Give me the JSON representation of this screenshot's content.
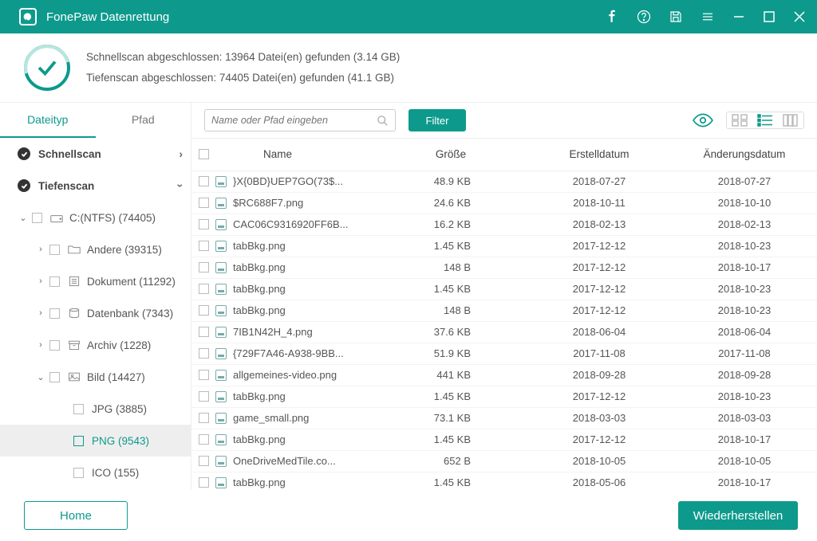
{
  "app": {
    "title": "FonePaw Datenrettung"
  },
  "status": {
    "line1": "Schnellscan abgeschlossen: 13964 Datei(en) gefunden (3.14 GB)",
    "line2": "Tiefenscan abgeschlossen: 74405 Datei(en) gefunden (41.1 GB)"
  },
  "tabs": {
    "filetype": "Dateityp",
    "path": "Pfad"
  },
  "tree": {
    "quickscan": "Schnellscan",
    "deepscan": "Tiefenscan",
    "drive": "C:(NTFS) (74405)",
    "cats": {
      "andere": "Andere (39315)",
      "dokument": "Dokument (11292)",
      "datenbank": "Datenbank (7343)",
      "archiv": "Archiv (1228)",
      "bild": "Bild (14427)"
    },
    "subs": {
      "jpg": "JPG (3885)",
      "png": "PNG (9543)",
      "ico": "ICO (155)"
    }
  },
  "toolbar": {
    "search_placeholder": "Name oder Pfad eingeben",
    "filter": "Filter"
  },
  "columns": {
    "name": "Name",
    "size": "Größe",
    "created": "Erstelldatum",
    "modified": "Änderungsdatum"
  },
  "rows": [
    {
      "name": "}X{0BD}UEP7GO(73$...",
      "size": "48.9 KB",
      "created": "2018-07-27",
      "modified": "2018-07-27"
    },
    {
      "name": "$RC688F7.png",
      "size": "24.6 KB",
      "created": "2018-10-11",
      "modified": "2018-10-10"
    },
    {
      "name": "CAC06C9316920FF6B...",
      "size": "16.2 KB",
      "created": "2018-02-13",
      "modified": "2018-02-13"
    },
    {
      "name": "tabBkg.png",
      "size": "1.45 KB",
      "created": "2017-12-12",
      "modified": "2018-10-23"
    },
    {
      "name": "tabBkg.png",
      "size": "148  B",
      "created": "2017-12-12",
      "modified": "2018-10-17"
    },
    {
      "name": "tabBkg.png",
      "size": "1.45 KB",
      "created": "2017-12-12",
      "modified": "2018-10-23"
    },
    {
      "name": "tabBkg.png",
      "size": "148  B",
      "created": "2017-12-12",
      "modified": "2018-10-23"
    },
    {
      "name": "7IB1N42H_4.png",
      "size": "37.6 KB",
      "created": "2018-06-04",
      "modified": "2018-06-04"
    },
    {
      "name": "{729F7A46-A938-9BB...",
      "size": "51.9 KB",
      "created": "2017-11-08",
      "modified": "2017-11-08"
    },
    {
      "name": "allgemeines-video.png",
      "size": "441 KB",
      "created": "2018-09-28",
      "modified": "2018-09-28"
    },
    {
      "name": "tabBkg.png",
      "size": "1.45 KB",
      "created": "2017-12-12",
      "modified": "2018-10-23"
    },
    {
      "name": "game_small.png",
      "size": "73.1 KB",
      "created": "2018-03-03",
      "modified": "2018-03-03"
    },
    {
      "name": "tabBkg.png",
      "size": "1.45 KB",
      "created": "2017-12-12",
      "modified": "2018-10-17"
    },
    {
      "name": "OneDriveMedTile.co...",
      "size": "652  B",
      "created": "2018-10-05",
      "modified": "2018-10-05"
    },
    {
      "name": "tabBkg.png",
      "size": "1.45 KB",
      "created": "2018-05-06",
      "modified": "2018-10-17"
    }
  ],
  "footer": {
    "home": "Home",
    "recover": "Wiederherstellen"
  }
}
